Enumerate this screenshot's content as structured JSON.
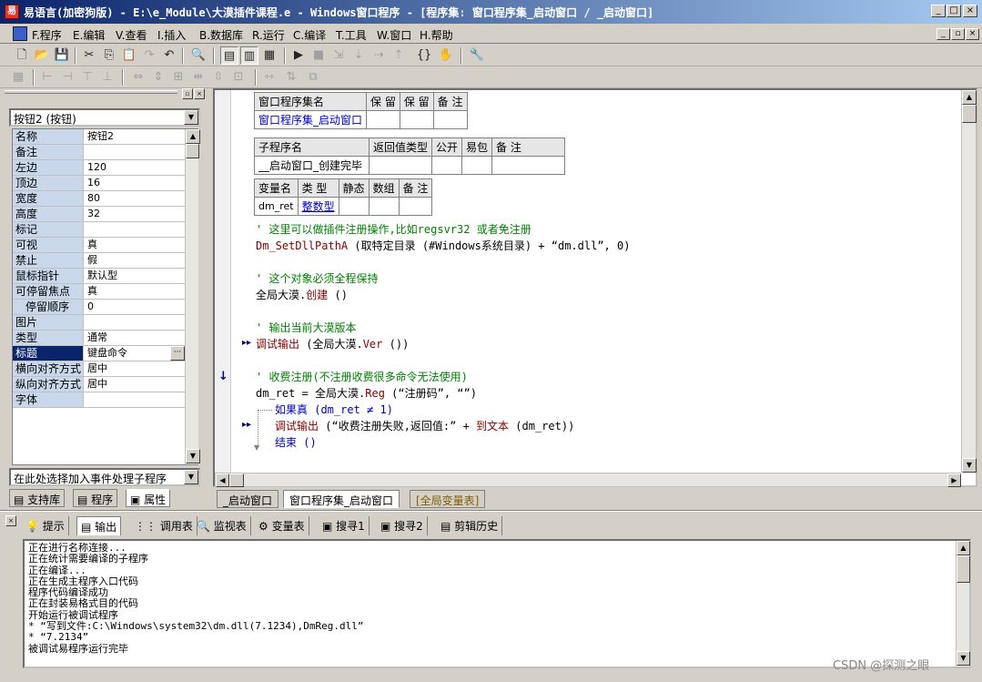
{
  "window": {
    "title": "易语言(加密狗版) - E:\\e_Module\\大漠插件课程.e - Windows窗口程序 - [程序集: 窗口程序集_启动窗口 / _启动窗口]",
    "app_icon": "易",
    "icon_color": "#e8332a",
    "titlebar_color": "#0a246a"
  },
  "menu": [
    "F.程序",
    "E.编辑",
    "V.查看",
    "I.插入",
    "B.数据库",
    "R.运行",
    "C.编译",
    "T.工具",
    "W.窗口",
    "H.帮助"
  ],
  "properties": {
    "selected_object": "按钮2 (按钮)",
    "rows": [
      {
        "k": "名称",
        "v": "按钮2"
      },
      {
        "k": "备注",
        "v": ""
      },
      {
        "k": "左边",
        "v": "120"
      },
      {
        "k": "顶边",
        "v": "16"
      },
      {
        "k": "宽度",
        "v": "80"
      },
      {
        "k": "高度",
        "v": "32"
      },
      {
        "k": "标记",
        "v": ""
      },
      {
        "k": "可视",
        "v": "真"
      },
      {
        "k": "禁止",
        "v": "假"
      },
      {
        "k": "鼠标指针",
        "v": "默认型"
      },
      {
        "k": "可停留焦点",
        "v": "真"
      },
      {
        "k": "停留顺序",
        "v": "0"
      },
      {
        "k": "图片",
        "v": ""
      },
      {
        "k": "类型",
        "v": "通常"
      },
      {
        "k": "标题",
        "v": "键盘命令"
      },
      {
        "k": "横向对齐方式",
        "v": "居中"
      },
      {
        "k": "纵向对齐方式",
        "v": "居中"
      },
      {
        "k": "字体",
        "v": ""
      }
    ],
    "event_select": "在此处选择加入事件处理子程序",
    "tabs": [
      "支持库",
      "程序",
      "属性"
    ]
  },
  "code": {
    "set_table": {
      "headers": [
        "窗口程序集名",
        "保 留",
        "保 留",
        "备 注"
      ],
      "row": [
        "窗口程序集_启动窗口",
        "",
        "",
        ""
      ]
    },
    "sub_table": {
      "headers": [
        "子程序名",
        "返回值类型",
        "公开",
        "易包",
        "备 注"
      ],
      "row": [
        "__启动窗口_创建完毕",
        "",
        "",
        "",
        ""
      ]
    },
    "var_table": {
      "headers": [
        "变量名",
        "类 型",
        "静态",
        "数组",
        "备 注"
      ],
      "row": [
        "dm_ret",
        "整数型",
        "",
        "",
        ""
      ]
    },
    "lines": {
      "c1": "' 这里可以做插件注册操作,比如regsvr32 或者免注册",
      "l1a": "Dm_SetDllPathA",
      "l1b": " (取特定目录 (#Windows系统目录) + “dm.dll”, 0)",
      "c2": "' 这个对象必须全程保持",
      "l2a": "全局大漠.",
      "l2b": "创建",
      "l2c": " ()",
      "c3": "' 输出当前大漠版本",
      "l3a": "调试输出",
      "l3b": " (全局大漠.",
      "l3c": "Ver",
      "l3d": " ())",
      "c4": "' 收费注册(不注册收费很多命令无法使用)",
      "l4a": "dm_ret = 全局大漠.",
      "l4b": "Reg",
      "l4c": " (“注册码”, “”)",
      "l5": "如果真 (dm_ret ≠ 1)",
      "l6a": "调试输出",
      "l6b": " (“收费注册失败,返回值:” + ",
      "l6c": "到文本",
      "l6d": " (dm_ret))",
      "l7": "结束 ()"
    },
    "tabs": [
      "_启动窗口",
      "窗口程序集_启动窗口",
      "[全局变量表]"
    ]
  },
  "bottom_tabs": [
    "提示",
    "输出",
    "调用表",
    "监视表",
    "变量表",
    "搜寻1",
    "搜寻2",
    "剪辑历史"
  ],
  "output": "正在进行名称连接...\n正在统计需要编译的子程序\n正在编译...\n正在生成主程序入口代码\n程序代码编译成功\n正在封装易格式目的代码\n开始运行被调试程序\n* “写到文件:C:\\Windows\\system32\\dm.dll(7.1234),DmReg.dll”\n* “7.2134”\n被调试易程序运行完毕",
  "watermark": "CSDN @探测之眼"
}
